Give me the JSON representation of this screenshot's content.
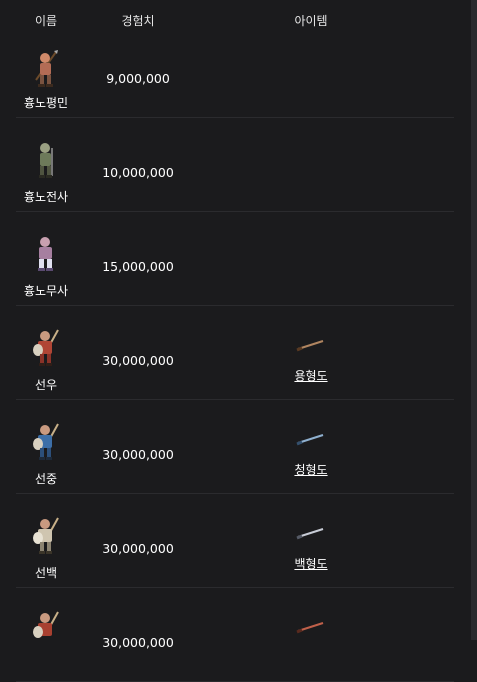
{
  "table": {
    "headers": {
      "name": "이름",
      "exp": "경험치",
      "item": "아이템"
    },
    "rows": [
      {
        "name": "흉노평민",
        "exp": "9,000,000",
        "item": ""
      },
      {
        "name": "흉노전사",
        "exp": "10,000,000",
        "item": ""
      },
      {
        "name": "흉노무사",
        "exp": "15,000,000",
        "item": ""
      },
      {
        "name": "선우",
        "exp": "30,000,000",
        "item": "용형도"
      },
      {
        "name": "선중",
        "exp": "30,000,000",
        "item": "청형도"
      },
      {
        "name": "선백",
        "exp": "30,000,000",
        "item": "백형도"
      },
      {
        "name": "",
        "exp": "30,000,000",
        "item": ""
      }
    ]
  },
  "icons": {
    "sprites": [
      "peasant-sprite-icon",
      "warrior-sprite-icon",
      "martial-sprite-icon",
      "chieftain-red-sprite-icon",
      "chieftain-blue-sprite-icon",
      "chieftain-white-sprite-icon",
      "chieftain-red-sprite-icon"
    ],
    "swords": [
      "bronze-sword-icon",
      "blue-sword-icon",
      "white-sword-icon",
      "red-sword-icon"
    ]
  },
  "colors": {
    "background": "#1b1b1d",
    "divider": "#2b2b2e",
    "text": "#ffffff"
  }
}
